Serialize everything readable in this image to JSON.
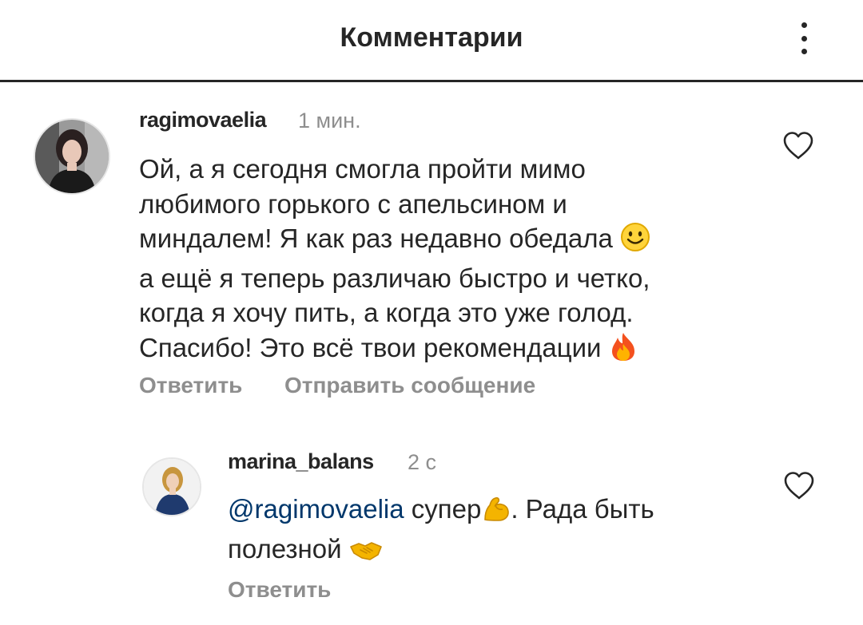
{
  "header": {
    "title": "Комментарии",
    "more_icon": "vertical-ellipsis-icon"
  },
  "comment": {
    "username": "ragimovaelia",
    "time": "1 мин.",
    "lines": [
      "Ой, а я сегодня смогла пройти мимо",
      "любимого горького с апельсином и",
      "миндалем! Я как раз недавно обедала",
      "а ещё я теперь различаю быстро и четко,",
      "когда я хочу пить, а когда это уже голод.",
      "Спасибо! Это всё твои рекомендации"
    ],
    "emoji_line3": "smiling-face-emoji",
    "emoji_line6": "fire-emoji",
    "reply_label": "Ответить",
    "message_label": "Отправить сообщение",
    "like_icon": "heart-outline-icon"
  },
  "reply": {
    "username": "marina_balans",
    "time": "2 с",
    "mention": "@ragimovaelia",
    "text_part1": "супер",
    "text_part2": ". Рада быть",
    "line2": "полезной",
    "emoji1": "flexed-biceps-emoji",
    "emoji2": "handshake-emoji",
    "reply_label": "Ответить",
    "like_icon": "heart-outline-icon"
  },
  "colors": {
    "text": "#262626",
    "secondary": "#8e8e8e",
    "mention": "#00376b",
    "divider": "#262626"
  }
}
